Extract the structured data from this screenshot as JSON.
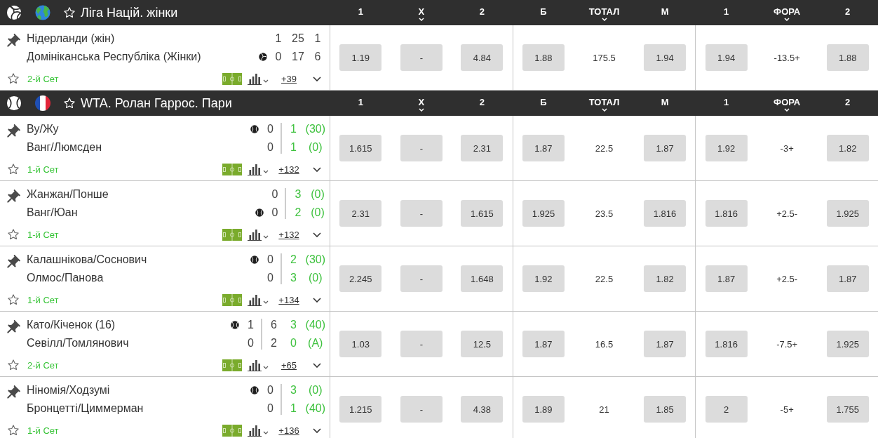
{
  "leagues": [
    {
      "kind": "volleyball",
      "title": "Ліга Націй. жінки",
      "column_groups": [
        [
          {
            "label": "1",
            "kind": "odd",
            "dropdown": false
          },
          {
            "label": "X",
            "kind": "odd",
            "dropdown": true
          },
          {
            "label": "2",
            "kind": "odd",
            "dropdown": false
          }
        ],
        [
          {
            "label": "Б",
            "kind": "odd",
            "dropdown": false
          },
          {
            "label": "ТОТАЛ",
            "kind": "line",
            "dropdown": true
          },
          {
            "label": "М",
            "kind": "odd",
            "dropdown": false
          }
        ],
        [
          {
            "label": "1",
            "kind": "odd",
            "dropdown": false
          },
          {
            "label": "ФОРА",
            "kind": "line",
            "dropdown": true
          },
          {
            "label": "2",
            "kind": "odd",
            "dropdown": false
          }
        ]
      ],
      "matches": [
        {
          "teams": [
            {
              "name": "Нідерланди (жін)",
              "serving": false
            },
            {
              "name": "Домініканська Республіка (Жінки)",
              "serving": true
            }
          ],
          "score": [
            {
              "live": false,
              "divider": false,
              "values": [
                "1",
                "0"
              ]
            },
            {
              "live": false,
              "divider": false,
              "values": [
                "25",
                "17"
              ]
            },
            {
              "live": false,
              "divider": false,
              "values": [
                "1",
                "6"
              ]
            }
          ],
          "period": "2-й Сет",
          "more": "+39",
          "odds": [
            [
              "1.19",
              "-",
              "4.84"
            ],
            [
              "1.88",
              "175.5",
              "1.94"
            ],
            [
              "1.94",
              "-13.5+",
              "1.88"
            ]
          ]
        }
      ]
    },
    {
      "kind": "tennis",
      "title": "WTA. Ролан Гаррос. Пари",
      "column_groups": [
        [
          {
            "label": "1",
            "kind": "odd",
            "dropdown": false
          },
          {
            "label": "X",
            "kind": "odd",
            "dropdown": true
          },
          {
            "label": "2",
            "kind": "odd",
            "dropdown": false
          }
        ],
        [
          {
            "label": "Б",
            "kind": "odd",
            "dropdown": false
          },
          {
            "label": "ТОТАЛ",
            "kind": "line",
            "dropdown": true
          },
          {
            "label": "М",
            "kind": "odd",
            "dropdown": false
          }
        ],
        [
          {
            "label": "1",
            "kind": "odd",
            "dropdown": false
          },
          {
            "label": "ФОРА",
            "kind": "line",
            "dropdown": true
          },
          {
            "label": "2",
            "kind": "odd",
            "dropdown": false
          }
        ]
      ],
      "matches": [
        {
          "teams": [
            {
              "name": "Ву/Жу",
              "serving": true
            },
            {
              "name": "Ванг/Люмсден",
              "serving": false
            }
          ],
          "score": [
            {
              "live": false,
              "divider": true,
              "values": [
                "0",
                "0"
              ]
            },
            {
              "live": true,
              "divider": false,
              "values": [
                "1",
                "1"
              ]
            },
            {
              "live": true,
              "divider": false,
              "values": [
                "(30)",
                "(0)"
              ]
            }
          ],
          "period": "1-й Сет",
          "more": "+132",
          "odds": [
            [
              "1.615",
              "-",
              "2.31"
            ],
            [
              "1.87",
              "22.5",
              "1.87"
            ],
            [
              "1.92",
              "-3+",
              "1.82"
            ]
          ]
        },
        {
          "teams": [
            {
              "name": "Жанжан/Понше",
              "serving": false
            },
            {
              "name": "Ванг/Юан",
              "serving": true
            }
          ],
          "score": [
            {
              "live": false,
              "divider": true,
              "values": [
                "0",
                "0"
              ]
            },
            {
              "live": true,
              "divider": false,
              "values": [
                "3",
                "2"
              ]
            },
            {
              "live": true,
              "divider": false,
              "values": [
                "(0)",
                "(0)"
              ]
            }
          ],
          "period": "1-й Сет",
          "more": "+132",
          "odds": [
            [
              "2.31",
              "-",
              "1.615"
            ],
            [
              "1.925",
              "23.5",
              "1.816"
            ],
            [
              "1.816",
              "+2.5-",
              "1.925"
            ]
          ]
        },
        {
          "teams": [
            {
              "name": "Калашнікова/Соснович",
              "serving": true
            },
            {
              "name": "Олмос/Панова",
              "serving": false
            }
          ],
          "score": [
            {
              "live": false,
              "divider": true,
              "values": [
                "0",
                "0"
              ]
            },
            {
              "live": true,
              "divider": false,
              "values": [
                "2",
                "3"
              ]
            },
            {
              "live": true,
              "divider": false,
              "values": [
                "(30)",
                "(0)"
              ]
            }
          ],
          "period": "1-й Сет",
          "more": "+134",
          "odds": [
            [
              "2.245",
              "-",
              "1.648"
            ],
            [
              "1.92",
              "22.5",
              "1.82"
            ],
            [
              "1.87",
              "+2.5-",
              "1.87"
            ]
          ]
        },
        {
          "teams": [
            {
              "name": "Като/Кіченок (16)",
              "serving": true
            },
            {
              "name": "Севілл/Томлянович",
              "serving": false
            }
          ],
          "score": [
            {
              "live": false,
              "divider": true,
              "values": [
                "1",
                "0"
              ]
            },
            {
              "live": false,
              "divider": false,
              "values": [
                "6",
                "2"
              ]
            },
            {
              "live": true,
              "divider": false,
              "values": [
                "3",
                "0"
              ]
            },
            {
              "live": true,
              "divider": false,
              "values": [
                "(40)",
                "(A)"
              ]
            }
          ],
          "period": "2-й Сет",
          "more": "+65",
          "odds": [
            [
              "1.03",
              "-",
              "12.5"
            ],
            [
              "1.87",
              "16.5",
              "1.87"
            ],
            [
              "1.816",
              "-7.5+",
              "1.925"
            ]
          ]
        },
        {
          "teams": [
            {
              "name": "Ніномія/Ходзумі",
              "serving": true
            },
            {
              "name": "Бронцетті/Циммерман",
              "serving": false
            }
          ],
          "score": [
            {
              "live": false,
              "divider": true,
              "values": [
                "0",
                "0"
              ]
            },
            {
              "live": true,
              "divider": false,
              "values": [
                "3",
                "1"
              ]
            },
            {
              "live": true,
              "divider": false,
              "values": [
                "(0)",
                "(40)"
              ]
            }
          ],
          "period": "1-й Сет",
          "more": "+136",
          "odds": [
            [
              "1.215",
              "-",
              "4.38"
            ],
            [
              "1.89",
              "21",
              "1.85"
            ],
            [
              "2",
              "-5+",
              "1.755"
            ]
          ]
        }
      ]
    }
  ]
}
